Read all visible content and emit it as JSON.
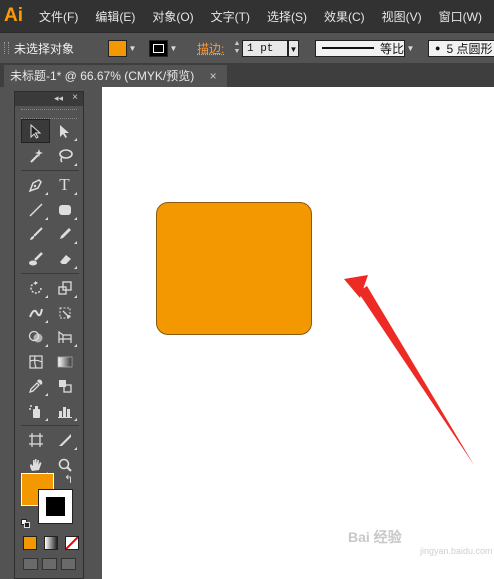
{
  "app": {
    "logo": "Ai"
  },
  "menu": {
    "items": [
      "文件(F)",
      "编辑(E)",
      "对象(O)",
      "文字(T)",
      "选择(S)",
      "效果(C)",
      "视图(V)",
      "窗口(W)"
    ]
  },
  "control_bar": {
    "selection_status": "未选择对象",
    "fill_color": "#f39800",
    "stroke_label": "描边:",
    "stroke_weight": "1 pt",
    "stroke_profile": "等比",
    "brush_label": "5 点圆形"
  },
  "document_tab": {
    "title": "未标题-1* @ 66.67% (CMYK/预览)",
    "close": "×"
  },
  "tools_panel": {
    "collapse_glyph": "◂◂",
    "close_glyph": "×",
    "fill_color": "#f39800",
    "stroke_color": "#000000",
    "tools": [
      [
        "selection-tool",
        "direct-selection-tool"
      ],
      [
        "magic-wand-tool",
        "lasso-tool"
      ],
      [
        "pen-tool",
        "type-tool"
      ],
      [
        "line-segment-tool",
        "rounded-rectangle-tool"
      ],
      [
        "paintbrush-tool",
        "pencil-tool"
      ],
      [
        "blob-brush-tool",
        "eraser-tool"
      ],
      [
        "rotate-tool",
        "scale-tool"
      ],
      [
        "width-tool",
        "free-transform-tool"
      ],
      [
        "shape-builder-tool",
        "perspective-grid-tool"
      ],
      [
        "mesh-tool",
        "gradient-tool"
      ],
      [
        "eyedropper-tool",
        "blend-tool"
      ],
      [
        "symbol-sprayer-tool",
        "column-graph-tool"
      ],
      [
        "artboard-tool",
        "slice-tool"
      ],
      [
        "hand-tool",
        "zoom-tool"
      ]
    ]
  },
  "canvas": {
    "shape_fill": "#f39800",
    "arrow_color": "#ee2a24"
  },
  "watermark": {
    "text": "Bai 经验",
    "subtext": "jingyan.baidu.com"
  }
}
